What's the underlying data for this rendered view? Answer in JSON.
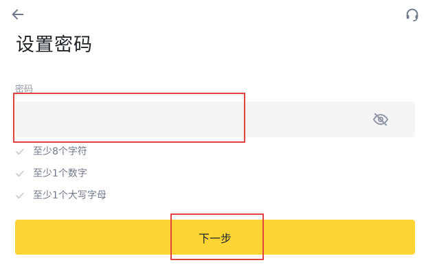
{
  "header": {
    "back_icon": "arrow-left-icon",
    "support_icon": "headset-icon"
  },
  "page": {
    "title": "设置密码"
  },
  "password_field": {
    "label": "密码",
    "value": "",
    "placeholder": "",
    "visibility_icon": "eye-off-icon"
  },
  "requirements": [
    {
      "text": "至少8个字符",
      "icon": "check-icon"
    },
    {
      "text": "至少1个数字",
      "icon": "check-icon"
    },
    {
      "text": "至少1个大写字母",
      "icon": "check-icon"
    }
  ],
  "next_button": {
    "label": "下一步"
  },
  "colors": {
    "accent": "#fcd535",
    "input_bg": "#f5f5f5",
    "muted_text": "#707a8a",
    "highlight": "#e04040"
  }
}
